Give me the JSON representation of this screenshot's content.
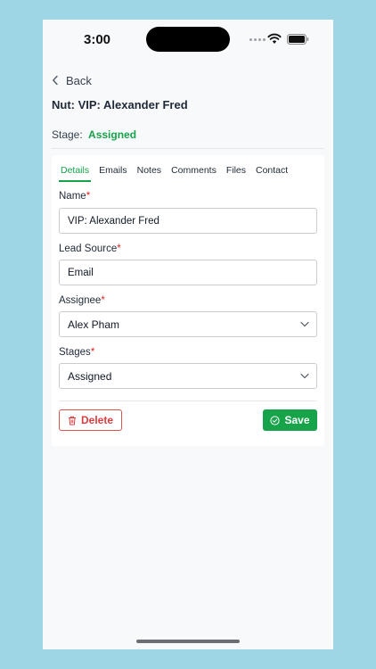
{
  "status_bar": {
    "time": "3:00"
  },
  "nav": {
    "back_label": "Back"
  },
  "page": {
    "title": "Nut: VIP: Alexander Fred",
    "stage_label": "Stage:",
    "stage_value": "Assigned"
  },
  "tabs": [
    {
      "label": "Details",
      "active": true
    },
    {
      "label": "Emails",
      "active": false
    },
    {
      "label": "Notes",
      "active": false
    },
    {
      "label": "Comments",
      "active": false
    },
    {
      "label": "Files",
      "active": false
    },
    {
      "label": "Contact",
      "active": false
    }
  ],
  "form": {
    "required_marker": "*",
    "name": {
      "label": "Name",
      "value": "VIP: Alexander Fred"
    },
    "lead_source": {
      "label": "Lead Source",
      "value": "Email"
    },
    "assignee": {
      "label": "Assignee",
      "value": "Alex Pham"
    },
    "stages": {
      "label": "Stages",
      "value": "Assigned"
    }
  },
  "actions": {
    "delete_label": "Delete",
    "save_label": "Save"
  },
  "colors": {
    "accent": "#16a34a",
    "danger": "#dc3c3c",
    "background": "#9fd6e6"
  }
}
